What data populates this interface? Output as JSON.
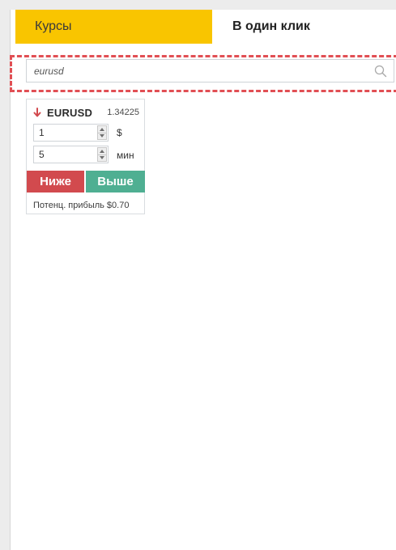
{
  "tabs": {
    "rates": "Курсы",
    "one_click": "В один клик"
  },
  "search": {
    "value": "eurusd",
    "placeholder": ""
  },
  "asset_card": {
    "direction_icon": "arrow-down-icon",
    "symbol": "EURUSD",
    "price": "1.34225",
    "amount": {
      "value": "1",
      "unit": "$"
    },
    "duration": {
      "value": "5",
      "unit": "мин"
    },
    "lower_button": "Ниже",
    "higher_button": "Выше",
    "potential_profit": "Потенц. прибыль $0.70"
  },
  "colors": {
    "active_tab": "#f9c500",
    "lower": "#d24a4e",
    "higher": "#4faf92",
    "highlight": "#e14f54",
    "arrow_down": "#d24a4e"
  }
}
